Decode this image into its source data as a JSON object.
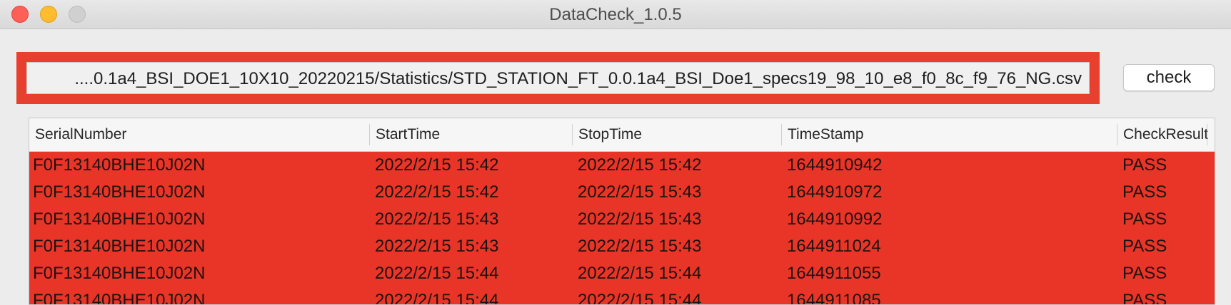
{
  "window": {
    "title": "DataCheck_1.0.5"
  },
  "path_field": {
    "value": "....0.1a4_BSI_DOE1_10X10_20220215/Statistics/STD_STATION_FT_0.0.1a4_BSI_Doe1_specs19_98_10_e8_f0_8c_f9_76_NG.csv",
    "highlight_color": "#e8402f"
  },
  "check_button": {
    "label": "check"
  },
  "table": {
    "columns": [
      "SerialNumber",
      "StartTime",
      "StopTime",
      "TimeStamp",
      "CheckResult"
    ],
    "row_color": "#e93527",
    "rows": [
      [
        "F0F13140BHE10J02N",
        "2022/2/15 15:42",
        "2022/2/15 15:42",
        "1644910942",
        "PASS"
      ],
      [
        "F0F13140BHE10J02N",
        "2022/2/15 15:42",
        "2022/2/15 15:43",
        "1644910972",
        "PASS"
      ],
      [
        "F0F13140BHE10J02N",
        "2022/2/15 15:43",
        "2022/2/15 15:43",
        "1644910992",
        "PASS"
      ],
      [
        "F0F13140BHE10J02N",
        "2022/2/15 15:43",
        "2022/2/15 15:43",
        "1644911024",
        "PASS"
      ],
      [
        "F0F13140BHE10J02N",
        "2022/2/15 15:44",
        "2022/2/15 15:44",
        "1644911055",
        "PASS"
      ],
      [
        "F0F13140BHE10J02N",
        "2022/2/15 15:44",
        "2022/2/15 15:44",
        "1644911085",
        "PASS"
      ]
    ]
  }
}
